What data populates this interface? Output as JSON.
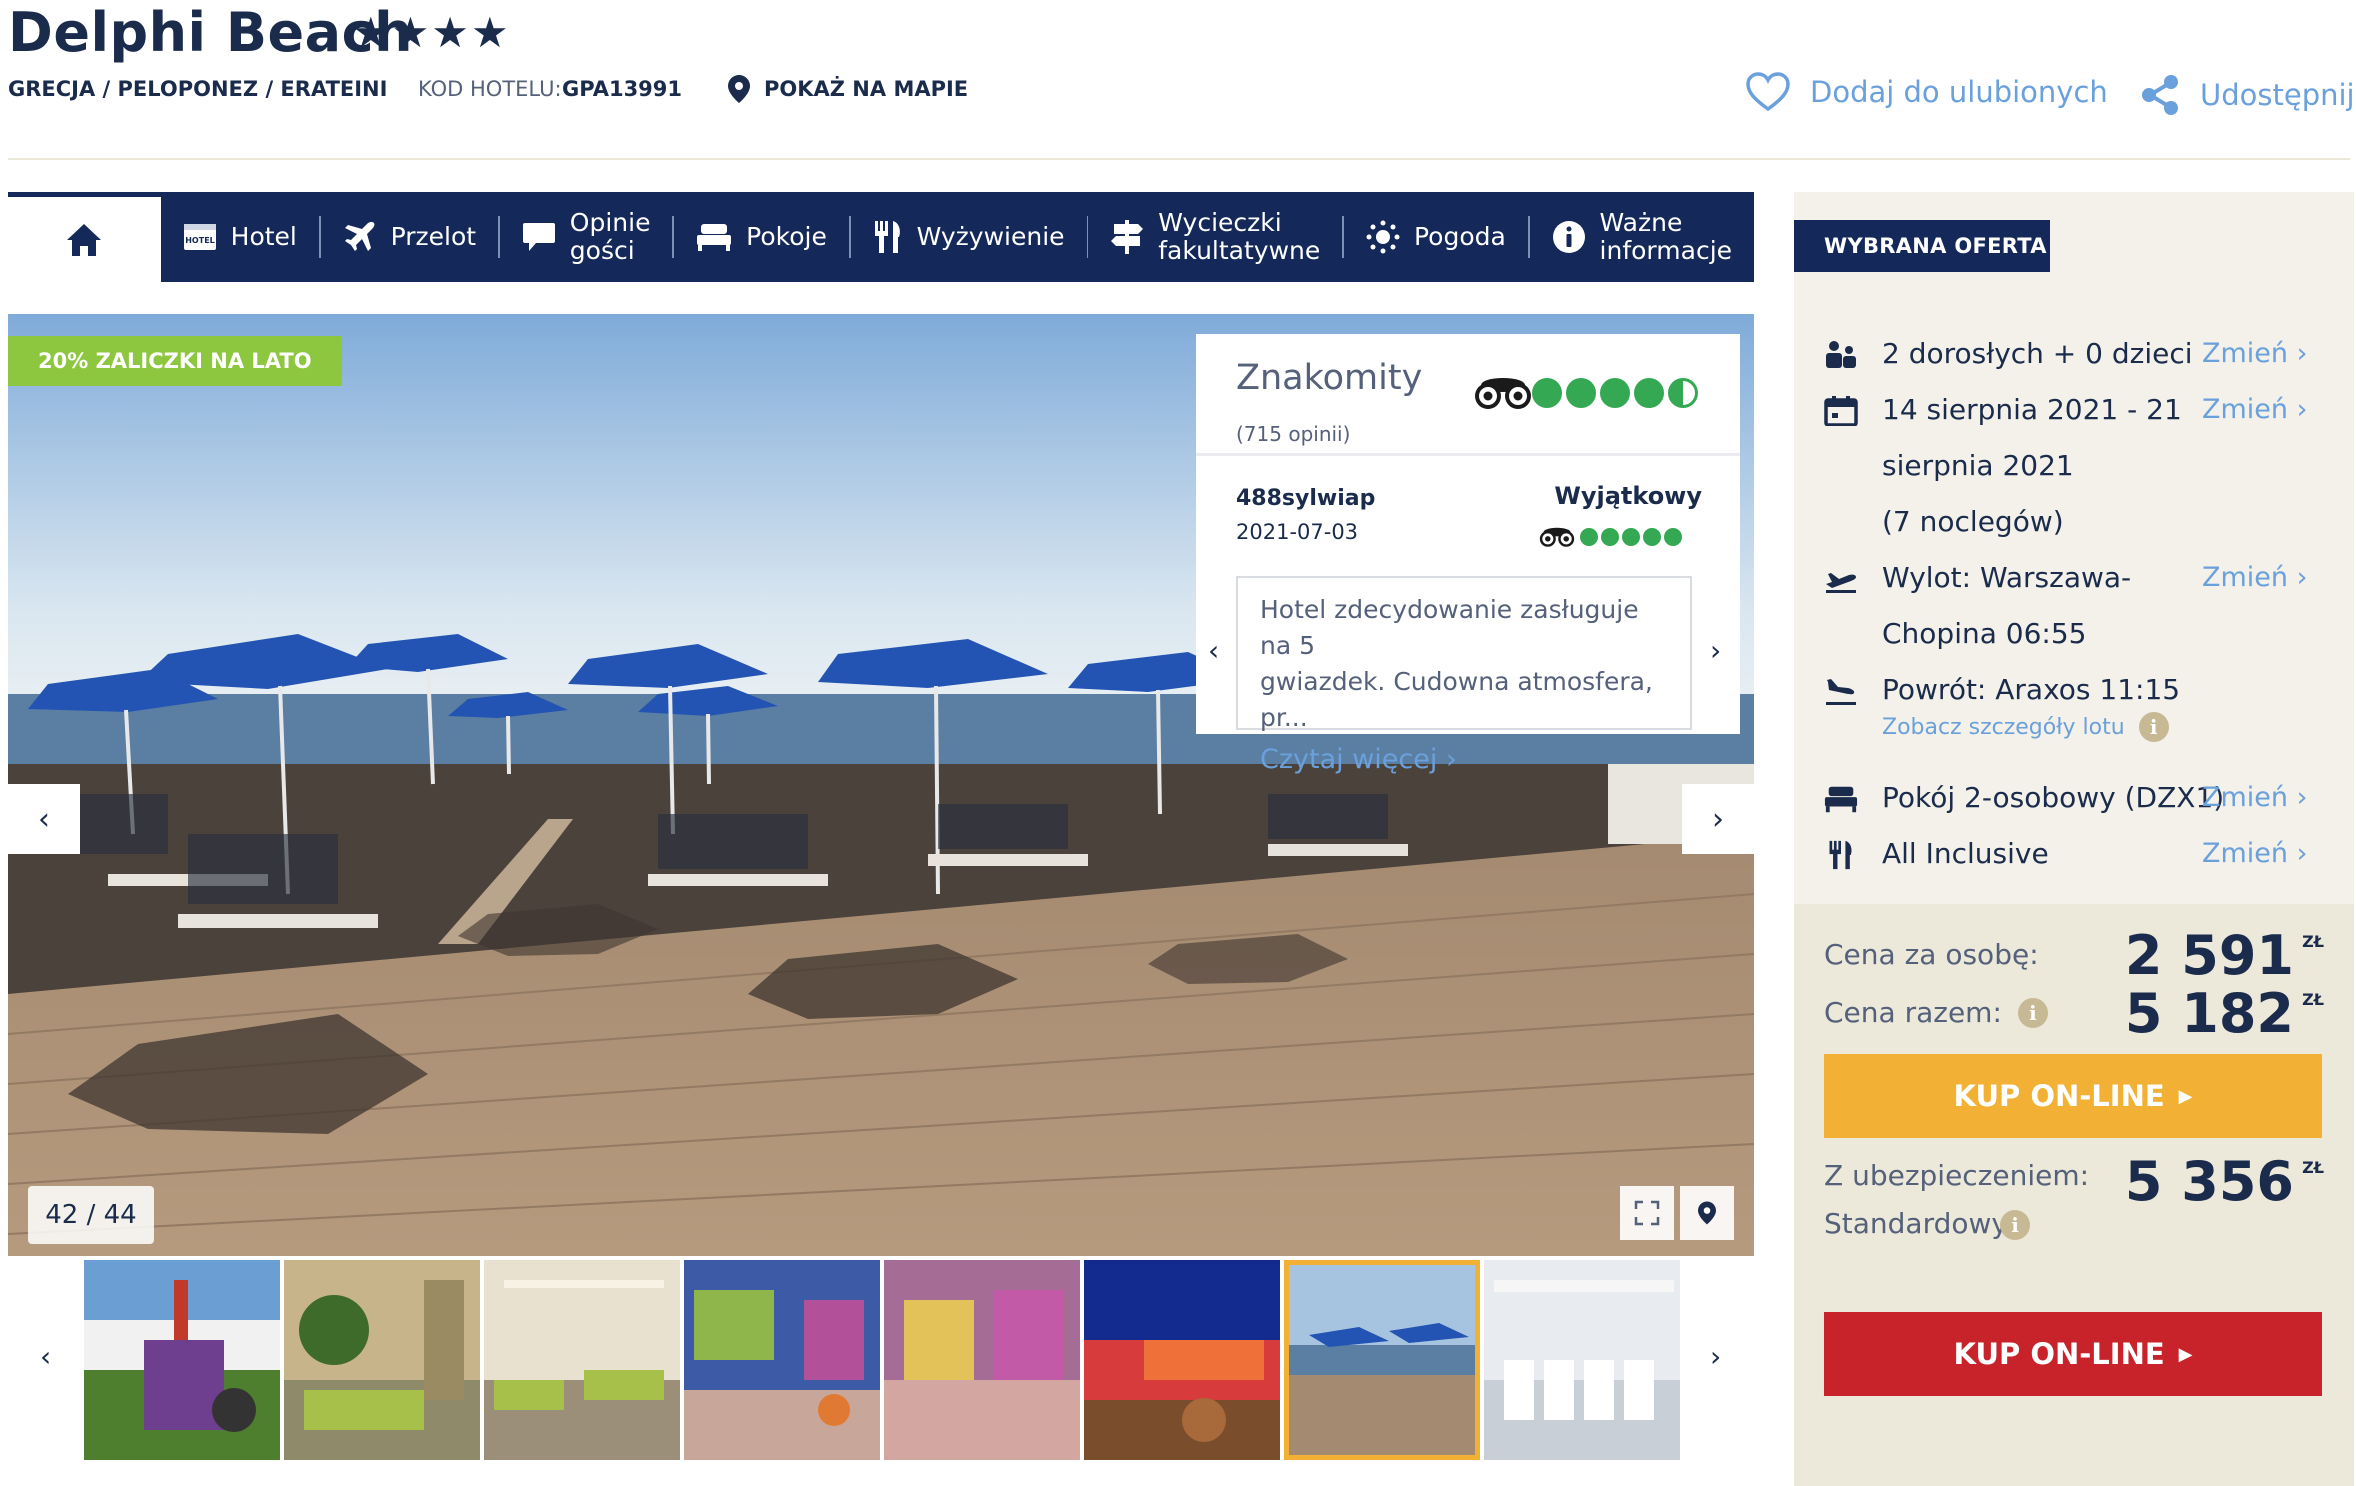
{
  "hotel": {
    "name": "Delphi Beach",
    "stars": "★★★★",
    "breadcrumb": "GRECJA / PELOPONEZ / ERATEINI",
    "code_label": "KOD HOTELU:",
    "code_value": "GPA13991",
    "map_link": "POKAŻ NA MAPIE"
  },
  "actions": {
    "favorite": "Dodaj do ulubionych",
    "share": "Udostępnij"
  },
  "nav": {
    "items": [
      {
        "label": "Hotel",
        "icon": "hotel-icon"
      },
      {
        "label": "Przelot",
        "icon": "plane-icon"
      },
      {
        "label": "Opinie\ngości",
        "icon": "comment-icon"
      },
      {
        "label": "Pokoje",
        "icon": "bed-icon"
      },
      {
        "label": "Wyżywienie",
        "icon": "cutlery-icon"
      },
      {
        "label": "Wycieczki\nfakultatywne",
        "icon": "signpost-icon"
      },
      {
        "label": "Pogoda",
        "icon": "sun-icon"
      },
      {
        "label": "Ważne\ninformacje",
        "icon": "info-icon"
      }
    ]
  },
  "gallery": {
    "promo": "20% ZALICZKI NA LATO",
    "counter": "42 / 44",
    "active_thumb": 7
  },
  "review": {
    "rating_label": "Znakomity",
    "count": "(715 opinii)",
    "user": "488sylwiap",
    "date": "2021-07-03",
    "verdict": "Wyjątkowy",
    "text": "Hotel zdecydowanie zasługuje na 5\ngwiazdek. Cudowna atmosfera, pr...",
    "more": "Czytaj więcej"
  },
  "offer": {
    "header": "WYBRANA OFERTA",
    "travellers": "2 dorosłych + 0 dzieci",
    "dates": "14 sierpnia 2021 - 21\nsierpnia 2021\n(7 noclegów)",
    "departure": "Wylot: Warszawa-\nChopina 06:55",
    "return": "Powrót: Araxos 11:15",
    "flight_details": "Zobacz szczegóły lotu",
    "room": "Pokój 2-osobowy (DZX1)",
    "board": "All Inclusive",
    "change_label": "Zmień"
  },
  "prices": {
    "per_person_label": "Cena za osobę:",
    "per_person": "2 591",
    "total_label": "Cena razem:",
    "total": "5 182",
    "insurance_label": "Z ubezpieczeniem:\nStandardowy",
    "insurance": "5 356",
    "currency": "ZŁ",
    "buy_label": "KUP ON-LINE",
    "colors": {
      "yellow": "#f2b134",
      "red": "#c8232b",
      "navy": "#14295a"
    }
  }
}
